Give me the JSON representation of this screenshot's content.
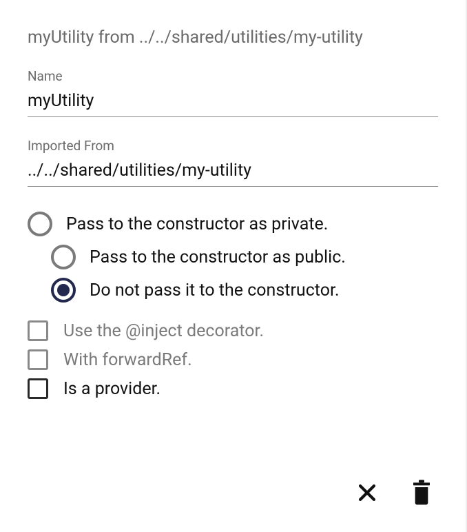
{
  "title": "myUtility from ../../shared/utilities/my-utility",
  "fields": {
    "name": {
      "label": "Name",
      "value": "myUtility"
    },
    "importedFrom": {
      "label": "Imported From",
      "value": "../../shared/utilities/my-utility"
    }
  },
  "radios": {
    "private": {
      "label": "Pass to the constructor as private.",
      "selected": false
    },
    "public": {
      "label": "Pass to the constructor as public.",
      "selected": false
    },
    "none": {
      "label": "Do not pass it to the constructor.",
      "selected": true
    }
  },
  "checks": {
    "inject": {
      "label": "Use the @inject decorator.",
      "checked": false,
      "disabled": true
    },
    "forwardRef": {
      "label": "With forwardRef.",
      "checked": false,
      "disabled": true
    },
    "provider": {
      "label": "Is a provider.",
      "checked": false,
      "disabled": false
    }
  },
  "actions": {
    "close": "close",
    "delete": "delete"
  }
}
